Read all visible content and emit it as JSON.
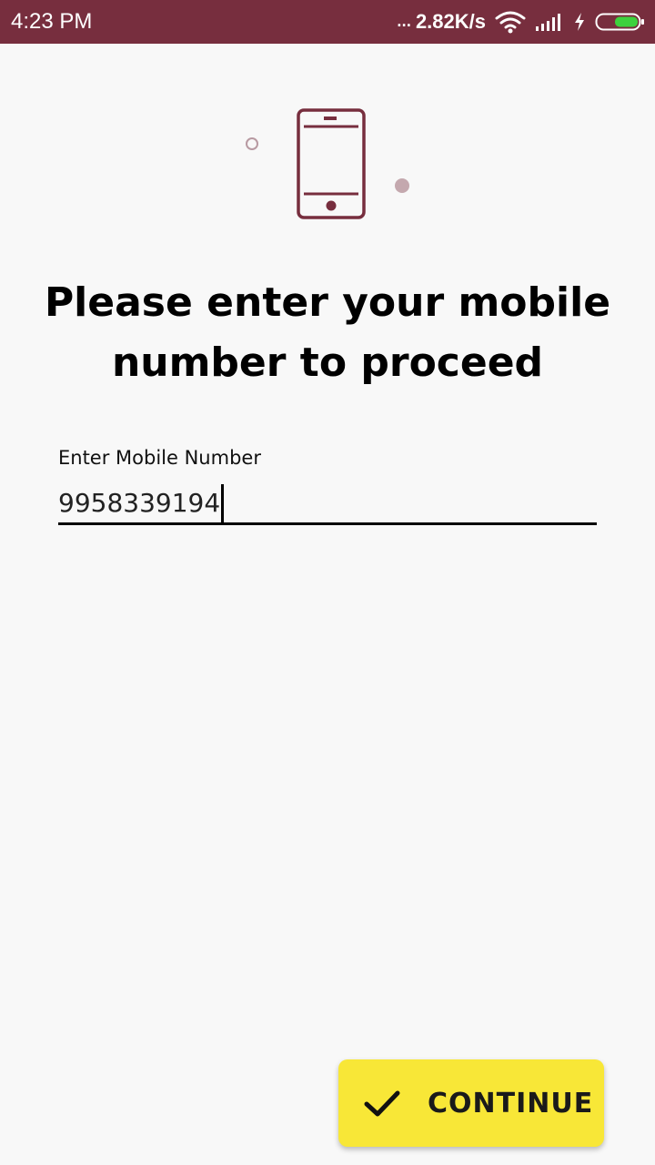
{
  "status_bar": {
    "time": "4:23 PM",
    "dots": "...",
    "network_speed": "2.82K/s",
    "icons": [
      "wifi-icon",
      "signal-icon",
      "charging-icon",
      "battery-icon"
    ],
    "background_color": "#772e3e"
  },
  "illustration": {
    "icon": "mobile-phone-icon",
    "color": "#772e3e"
  },
  "heading": "Please enter your mobile number to proceed",
  "mobile_field": {
    "label": "Enter Mobile Number",
    "value": "9958339194"
  },
  "continue_button": {
    "icon": "check-icon",
    "label": "CONTINUE",
    "color": "#f8e737"
  }
}
